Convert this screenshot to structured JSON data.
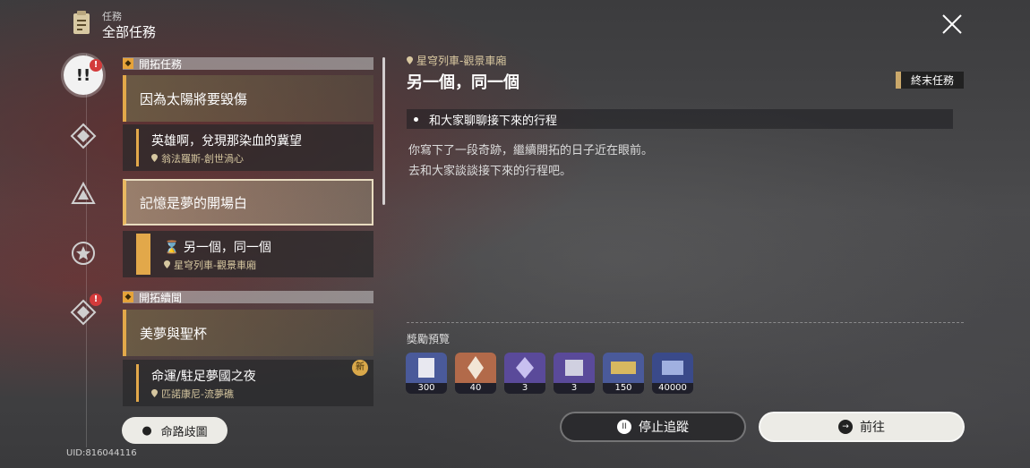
{
  "header": {
    "category": "任務",
    "title": "全部任務"
  },
  "rail": [
    {
      "icon": "trailblaze-mission-icon",
      "active": true,
      "badge": "!"
    },
    {
      "icon": "companion-mission-icon",
      "active": false
    },
    {
      "icon": "adventure-mission-icon",
      "active": false
    },
    {
      "icon": "daily-mission-icon",
      "active": false
    },
    {
      "icon": "event-mission-icon",
      "active": false,
      "badge": "!"
    }
  ],
  "quest_list": {
    "section1": {
      "label": "開拓任務"
    },
    "items": [
      {
        "type": "main",
        "title": "因為太陽將要毀傷"
      },
      {
        "type": "sub",
        "title": "英雄啊，兌現那染血的冀望",
        "location": "翁法羅斯-創世渦心"
      },
      {
        "type": "main",
        "title": "記憶是夢的開場白",
        "selected": true
      },
      {
        "type": "sub",
        "title": "另一個，同一個",
        "location": "星穹列車-觀景車廂",
        "tracking": true
      },
      {
        "type": "main",
        "title": "美夢與聖杯"
      },
      {
        "type": "sub",
        "title": "命運/駐足夢國之夜",
        "location": "匹諾康尼-流夢礁",
        "new": "新"
      }
    ],
    "section2": {
      "label": "開拓續聞"
    }
  },
  "detail": {
    "location": "星穹列車-觀景車廂",
    "title": "另一個，同一個",
    "tag": "終末任務",
    "objective": "和大家聊聊接下來的行程",
    "description": [
      "你寫下了一段奇跡，繼續開拓的日子近在眼前。",
      "去和大家談談接下來的行程吧。"
    ],
    "reward_label": "獎勵預覽",
    "rewards": [
      {
        "icon": "exp-material-icon",
        "count": "300",
        "color": "#4a5a9a"
      },
      {
        "icon": "stellar-jade-icon",
        "count": "40",
        "color": "#b26a4a"
      },
      {
        "icon": "lightcone-exp-icon",
        "count": "3",
        "color": "#5a4a9a"
      },
      {
        "icon": "refined-aether-icon",
        "count": "3",
        "color": "#5a4a9a"
      },
      {
        "icon": "credit-ticket-icon",
        "count": "150",
        "color": "#4a5a9a"
      },
      {
        "icon": "credit-icon",
        "count": "40000",
        "color": "#3a4a8a"
      }
    ]
  },
  "buttons": {
    "stop": "停止追蹤",
    "go": "前往",
    "map": "命路歧圖"
  },
  "uid": "UID:816044116",
  "colors": {
    "accent": "#e2a84a",
    "badge": "#d33b3b"
  }
}
